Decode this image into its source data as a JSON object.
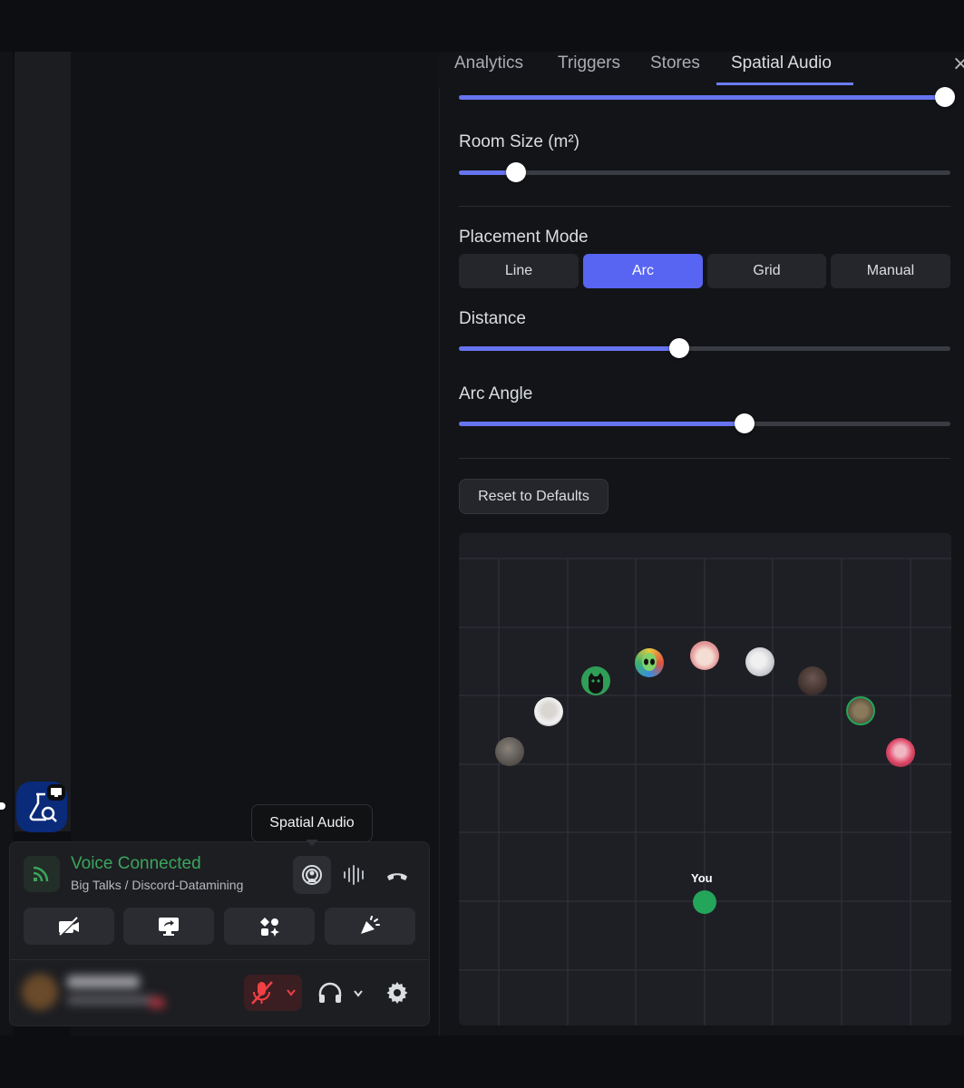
{
  "tabs": [
    {
      "label": "Analytics"
    },
    {
      "label": "Triggers"
    },
    {
      "label": "Stores"
    },
    {
      "label": "Spatial Audio"
    }
  ],
  "close_icon": "close-icon",
  "settings": {
    "top_slider_value": 1.0,
    "room_size": {
      "label": "Room Size (m²)",
      "value": 0.12
    },
    "placement_mode": {
      "label": "Placement Mode",
      "options": [
        "Line",
        "Arc",
        "Grid",
        "Manual"
      ],
      "selected": "Arc"
    },
    "distance": {
      "label": "Distance",
      "value": 0.45
    },
    "arc_angle": {
      "label": "Arc Angle",
      "value": 0.58
    },
    "reset_label": "Reset to Defaults"
  },
  "spatial_view": {
    "you_label": "You",
    "you_color": "#23a55a",
    "participant_count": 9
  },
  "voice": {
    "tooltip": "Spatial Audio",
    "status": "Voice Connected",
    "channel": "Big Talks / Discord-Datamining",
    "status_color": "#3ba55c"
  },
  "colors": {
    "accent": "#5865f2",
    "slider_fill": "#6674f0",
    "danger": "#f23f43"
  }
}
